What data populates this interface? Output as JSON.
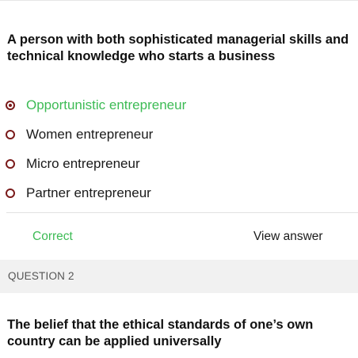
{
  "question1": {
    "text": "A person with both sophisticated managerial skills and technical knowledge who starts a business",
    "options": [
      {
        "label": "Opportunistic entrepreneur",
        "selected": true,
        "correct": true
      },
      {
        "label": "Women entrepreneur",
        "selected": false,
        "correct": false
      },
      {
        "label": "Micro entrepreneur",
        "selected": false,
        "correct": false
      },
      {
        "label": "Partner entrepreneur",
        "selected": false,
        "correct": false
      }
    ],
    "result_label": "Correct",
    "view_answer_label": "View answer"
  },
  "question2": {
    "header": "QUESTION 2",
    "text": "The belief that the ethical standards of one’s own country can be applied universally"
  },
  "colors": {
    "correct": "#3dbb55",
    "radio": "#7a1a1a",
    "header_bg": "#f1f1f1"
  }
}
